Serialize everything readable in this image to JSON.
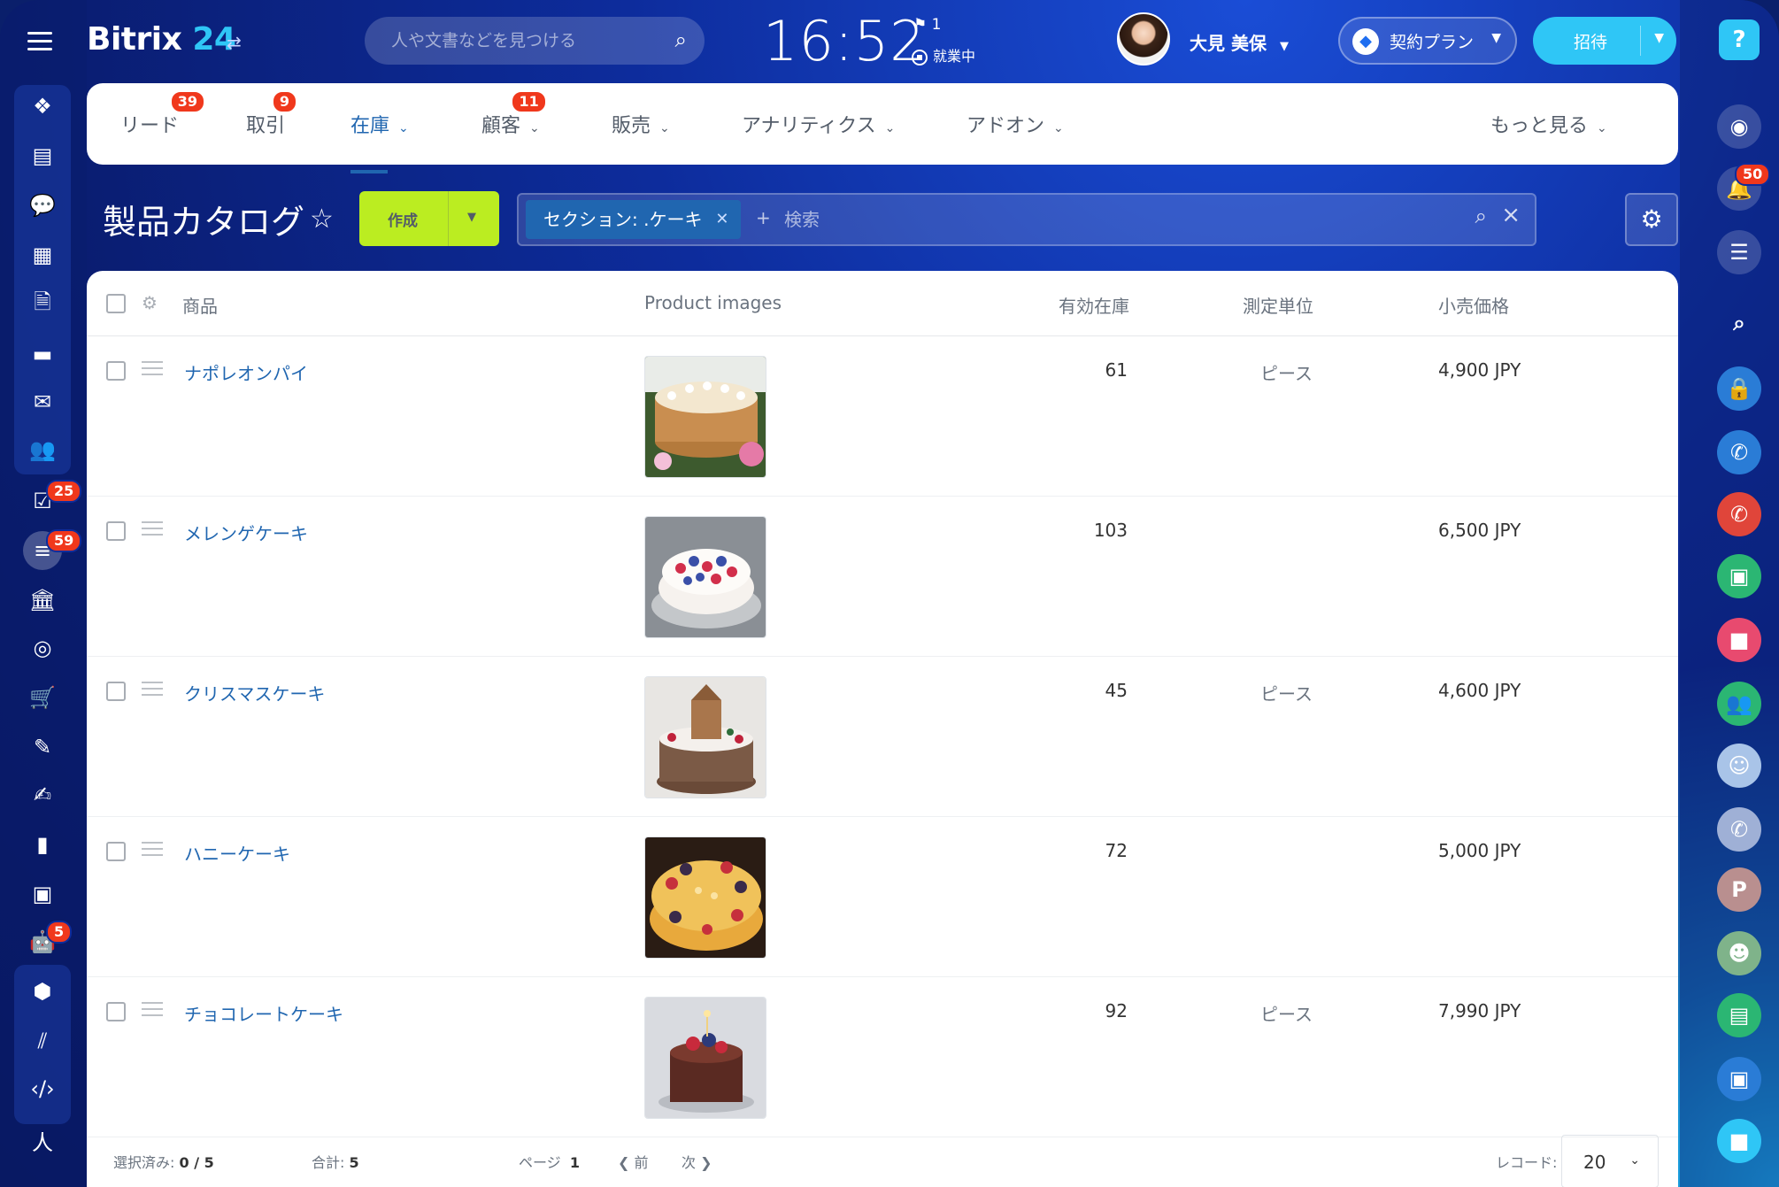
{
  "app": {
    "logo_main": "Bitrix",
    "logo_num": "24"
  },
  "header": {
    "search_placeholder": "人や文書などを見つける",
    "time": "16:52",
    "flag_count": "1",
    "work_status": "就業中",
    "user_name": "大見 美保",
    "plan_label": "契約プラン",
    "invite_label": "招待"
  },
  "left_sidebar": {
    "badges": {
      "tasks": "25",
      "crm": "59",
      "robots": "5"
    }
  },
  "right_sidebar": {
    "notifications_badge": "50",
    "user_initial": "P"
  },
  "tabs": [
    {
      "label": "リード",
      "badge": "39"
    },
    {
      "label": "取引",
      "badge": "9"
    },
    {
      "label": "在庫",
      "active": true
    },
    {
      "label": "顧客",
      "badge": "11"
    },
    {
      "label": "販売"
    },
    {
      "label": "アナリティクス"
    },
    {
      "label": "アドオン"
    },
    {
      "label": "もっと見る"
    }
  ],
  "page": {
    "title": "製品カタログ",
    "create_label": "作成",
    "filter_chip": "セクション: .ケーキ",
    "filter_placeholder": "検索"
  },
  "grid": {
    "columns": {
      "product": "商品",
      "images": "Product images",
      "stock": "有効在庫",
      "unit": "測定単位",
      "price": "小売価格"
    },
    "rows": [
      {
        "name": "ナポレオンパイ",
        "stock": "61",
        "unit": "ピース",
        "price": "4,900 JPY"
      },
      {
        "name": "メレンゲケーキ",
        "stock": "103",
        "unit": "",
        "price": "6,500 JPY"
      },
      {
        "name": "クリスマスケーキ",
        "stock": "45",
        "unit": "ピース",
        "price": "4,600 JPY"
      },
      {
        "name": "ハニーケーキ",
        "stock": "72",
        "unit": "",
        "price": "5,000 JPY"
      },
      {
        "name": "チョコレートケーキ",
        "stock": "92",
        "unit": "ピース",
        "price": "7,990 JPY"
      }
    ]
  },
  "footer": {
    "selected_label": "選択済み:",
    "selected_value": "0 / 5",
    "total_label": "合計:",
    "total_value": "5",
    "page_label": "ページ",
    "page_value": "1",
    "prev_label": "前",
    "next_label": "次",
    "records_label": "レコード:",
    "records_value": "20"
  }
}
